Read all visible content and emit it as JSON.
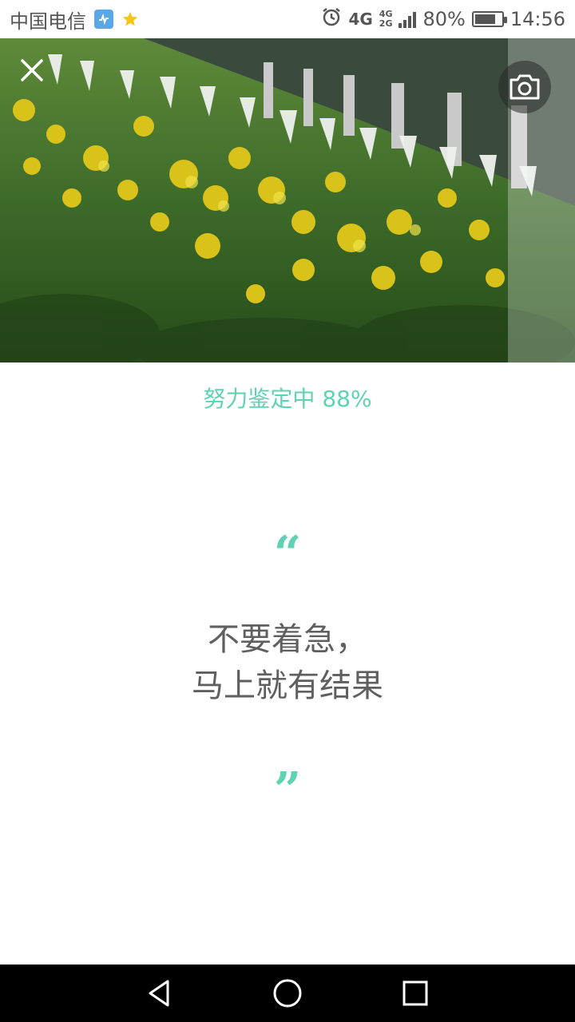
{
  "status_bar": {
    "carrier": "中国电信",
    "network_primary": "4G",
    "network_secondary_top": "4G",
    "network_secondary_bottom": "2G",
    "battery_percent": "80%",
    "battery_level": 0.8,
    "time": "14:56",
    "icons": [
      "app-badge-icon",
      "star-icon",
      "alarm-icon",
      "signal-icon",
      "battery-icon"
    ]
  },
  "photo": {
    "icons": [
      "close-icon",
      "camera-icon"
    ]
  },
  "progress": {
    "label": "努力鉴定中 88%",
    "value": 0.88
  },
  "quote": {
    "open_mark": "“",
    "line1": "不要着急，",
    "line2": "马上就有结果",
    "close_mark": "”"
  },
  "nav_bar": {
    "icons": [
      "back-icon",
      "home-icon",
      "recents-icon"
    ]
  },
  "colors": {
    "accent": "#5fd2b4",
    "quote_text": "#5f5f5f",
    "nav_bg": "#000000"
  }
}
